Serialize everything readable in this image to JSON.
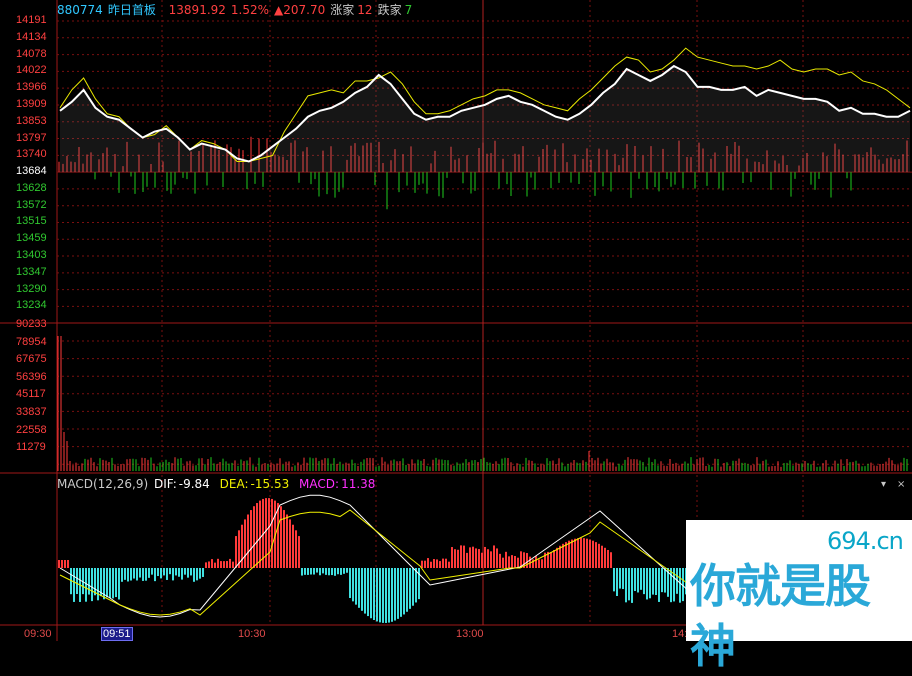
{
  "header": {
    "code": "880774",
    "name": "昨日首板",
    "price": "13891.92",
    "pct": "1.52%",
    "change": "▲207.70",
    "up_label": "涨家",
    "up_count": "12",
    "down_label": "跌家",
    "down_count": "7"
  },
  "macd": {
    "title": "MACD(12,26,9)",
    "dif_label": "DIF:",
    "dif_value": "-9.84",
    "dea_label": "DEA:",
    "dea_value": "-15.53",
    "macd_label": "MACD:",
    "macd_value": "11.38",
    "dropdown_glyph": "▾",
    "close_glyph": "×"
  },
  "price_axis": [
    "14191",
    "14134",
    "14078",
    "14022",
    "13966",
    "13909",
    "13853",
    "13797",
    "13740",
    "13684",
    "13628",
    "13572",
    "13515",
    "13459",
    "13403",
    "13347",
    "13290",
    "13234"
  ],
  "volume_axis": [
    "90233",
    "78954",
    "67675",
    "56396",
    "45117",
    "33837",
    "22558",
    "11279"
  ],
  "time_axis": [
    "09:30",
    "10:30",
    "13:00",
    "14:"
  ],
  "cursor_time": "09:51",
  "watermark": {
    "domain": "694.cn",
    "text": "你就是股神"
  },
  "colors": {
    "up": "#ff3a3a",
    "down": "#1ecb1e",
    "price_line": "#ffffff",
    "avg_line": "#e8e800",
    "grid": "#7a1010",
    "axis_label_up": "#ff4040",
    "axis_label_down": "#30c830",
    "axis_label_base": "#ffffff",
    "macd_neg": "#40e0e0",
    "dea_color": "#f0f000",
    "macd_color": "#ff30ff"
  },
  "chart_data": {
    "type": "line",
    "base_price": 13684,
    "ylim": [
      13234,
      14191
    ],
    "series": [
      {
        "values": [
          13900,
          13960,
          14000,
          13930,
          13880,
          13870,
          13830,
          13800,
          13810,
          13840,
          13800,
          13760,
          13790,
          13780,
          13760,
          13720,
          13720,
          13730,
          13740,
          13820,
          13880,
          13940,
          13950,
          13960,
          13950,
          13990,
          13990,
          14000,
          14020,
          13980,
          13920,
          13880,
          13880,
          13890,
          13910,
          13930,
          13940,
          13960,
          13960,
          13950,
          13930,
          13910,
          13900,
          13890,
          13930,
          13960,
          14000,
          14040,
          14070,
          14060,
          14020,
          14030,
          14060,
          14100,
          14070,
          14060,
          14050,
          14040,
          14040,
          14030,
          14040,
          14060,
          14030,
          14020,
          14030,
          14030,
          14010,
          14020,
          13990,
          13980,
          13960,
          13930,
          13900
        ]
      },
      {
        "values": [
          13890,
          13920,
          13960,
          13900,
          13870,
          13860,
          13830,
          13800,
          13820,
          13830,
          13800,
          13760,
          13780,
          13770,
          13760,
          13730,
          13720,
          13740,
          13770,
          13800,
          13830,
          13870,
          13890,
          13900,
          13920,
          13950,
          13970,
          14010,
          13980,
          13930,
          13880,
          13860,
          13870,
          13870,
          13890,
          13900,
          13910,
          13930,
          13940,
          13920,
          13910,
          13890,
          13870,
          13860,
          13880,
          13910,
          13950,
          13980,
          14030,
          14010,
          13990,
          14010,
          14040,
          14020,
          13970,
          13970,
          13960,
          13960,
          13970,
          13940,
          13960,
          13950,
          13940,
          13930,
          13930,
          13920,
          13890,
          13900,
          13880,
          13880,
          13870,
          13870,
          13890
        ]
      }
    ]
  }
}
